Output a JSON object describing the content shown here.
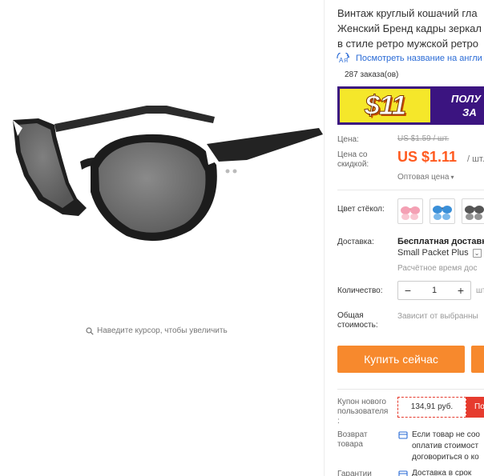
{
  "gallery": {
    "zoom_hint": "Наведите курсор, чтобы увеличить"
  },
  "product": {
    "title_lines": [
      "Винтаж круглый кошачий гла",
      "Женский Бренд кадры зеркал",
      "в стиле ретро мужской ретро"
    ],
    "translate_link": "Посмотреть название на англи",
    "orders": "287 заказа(ов)"
  },
  "banner": {
    "amount": "$11",
    "text_line1": "ПОЛУ",
    "text_line2": "ЗА"
  },
  "price": {
    "label": "Цена:",
    "old": "US $1.59 / шт.",
    "discount_label_line1": "Цена со",
    "discount_label_line2": "скидкой:",
    "new": "US $1.11",
    "unit": "/ шт.",
    "wholesale": "Оптовая цена"
  },
  "color": {
    "label": "Цвет стёкол:",
    "swatches": [
      "pink-lens-sunglasses",
      "blue-lens-sunglasses",
      "grey-lens-sunglasses"
    ]
  },
  "shipping": {
    "label": "Доставка:",
    "title": "Бесплатная доставк",
    "method": "Small Packet Plus",
    "eta": "Расчётное время дос"
  },
  "quantity": {
    "label": "Количество:",
    "minus": "−",
    "value": "1",
    "plus": "+",
    "unit": "шт"
  },
  "total": {
    "label_line1": "Общая",
    "label_line2": "стоимость:",
    "note": "Зависит от выбранны"
  },
  "actions": {
    "buy_now": "Купить сейчас"
  },
  "coupon": {
    "label_line1": "Купон нового",
    "label_line2": "пользователя",
    "label_line3": ":",
    "value": "134,91 руб.",
    "get": "По"
  },
  "returns": {
    "label_line1": "Возврат",
    "label_line2": "товара",
    "text_line1": "Если товар не соо",
    "text_line2": "оплатив стоимост",
    "text_line3": "договориться о ко"
  },
  "guarantee": {
    "label": "Гарантии",
    "text": "Доставка в срок"
  },
  "colors": {
    "accent": "#ff5a1f",
    "buy_button": "#f7892d",
    "link": "#2a6bd6",
    "banner_bg": "#3b1480",
    "banner_yellow": "#f5e72a",
    "coupon_red": "#e63b2e"
  }
}
